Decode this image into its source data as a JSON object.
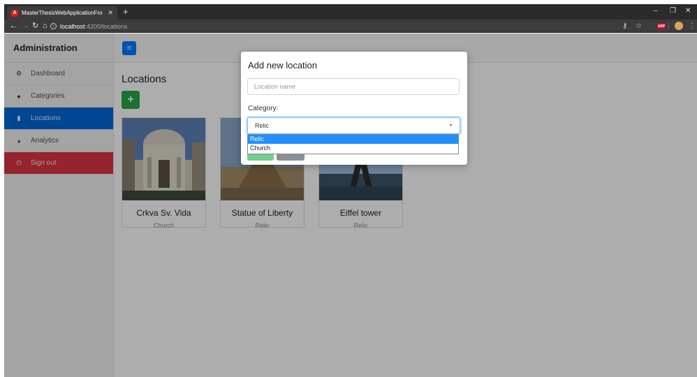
{
  "browser": {
    "tab_title": "MasterThesisWebApplicationFro",
    "tab_favicon": "A",
    "new_tab": "+",
    "url_host": "localhost",
    "url_path": ":4200/locations",
    "close": "✕",
    "minimize": "–",
    "restore": "❐",
    "close_window": "✕"
  },
  "sidebar": {
    "title": "Administration",
    "items": [
      {
        "label": "Dashboard",
        "icon": "dashboard-icon",
        "glyph": "⚙"
      },
      {
        "label": "Categories",
        "icon": "circle-icon",
        "glyph": "●"
      },
      {
        "label": "Locations",
        "icon": "map-icon",
        "glyph": "▮"
      },
      {
        "label": "Analytics",
        "icon": "pie-chart-icon",
        "glyph": "◕"
      },
      {
        "label": "Sign out",
        "icon": "power-icon",
        "glyph": "⏻"
      }
    ]
  },
  "main": {
    "menu_glyph": "≡",
    "title": "Locations",
    "add_glyph": "+",
    "cards": [
      {
        "title": "Crkva Sv. Vida",
        "category": "Church"
      },
      {
        "title": "Statue of Liberty",
        "category": "Relic"
      },
      {
        "title": "Eiffel tower",
        "category": "Relic"
      }
    ]
  },
  "modal": {
    "title": "Add new location",
    "name_placeholder": "Location name",
    "category_label": "Category:",
    "selected_category": "Relic",
    "options": [
      "Relic",
      "Church"
    ]
  },
  "colors": {
    "primary": "#007bff",
    "success": "#28a745",
    "danger": "#dc3545"
  }
}
